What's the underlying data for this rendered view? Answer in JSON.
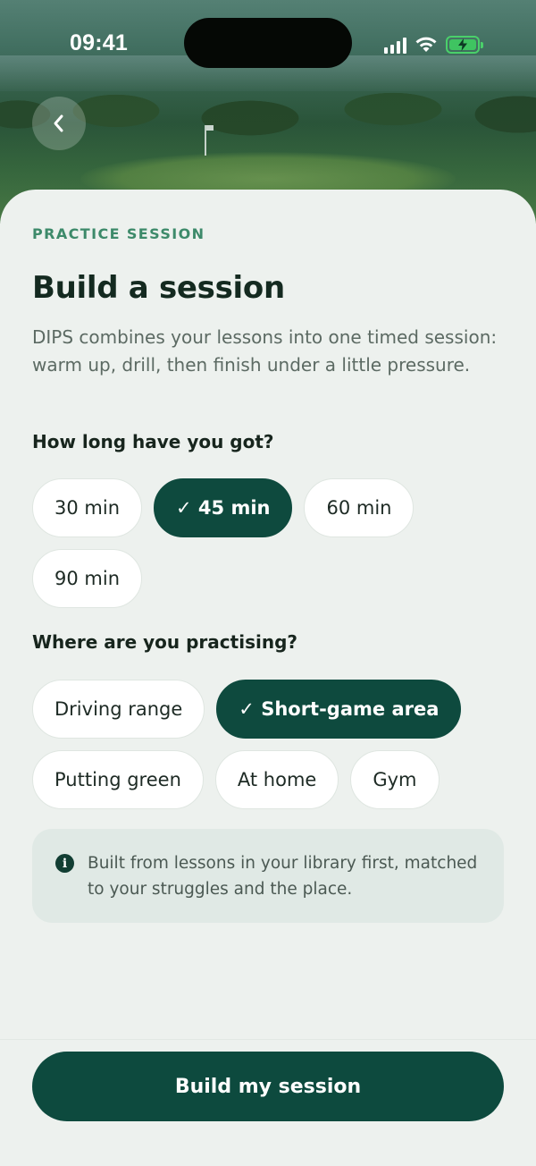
{
  "status_bar": {
    "time": "09:41",
    "icons": [
      "signal-icon",
      "wifi-icon",
      "battery-charging-icon"
    ],
    "battery_color": "#3fc461"
  },
  "header": {
    "back_icon": "chevron-left-icon"
  },
  "content": {
    "eyebrow": "PRACTICE SESSION",
    "title": "Build a session",
    "intro": "DIPS combines your lessons into one timed session: warm up, drill, then finish under a little pressure."
  },
  "duration": {
    "label": "How long have you got?",
    "options": [
      {
        "label": "30 min",
        "selected": false
      },
      {
        "label": "✓ 45 min",
        "selected": true
      },
      {
        "label": "60 min",
        "selected": false
      },
      {
        "label": "90 min",
        "selected": false
      }
    ]
  },
  "location": {
    "label": "Where are you practising?",
    "options": [
      {
        "label": "Driving range",
        "selected": false
      },
      {
        "label": "✓ Short-game area",
        "selected": true
      },
      {
        "label": "Putting green",
        "selected": false
      },
      {
        "label": "At home",
        "selected": false
      },
      {
        "label": "Gym",
        "selected": false
      }
    ]
  },
  "info": {
    "icon": "info-icon",
    "text": "Built from lessons in your library first, matched to your struggles and the place."
  },
  "cta": {
    "label": "Build my session"
  },
  "colors": {
    "accent": "#0e4a3e",
    "eyebrow": "#3d8a6a",
    "background": "#edf1ee"
  }
}
